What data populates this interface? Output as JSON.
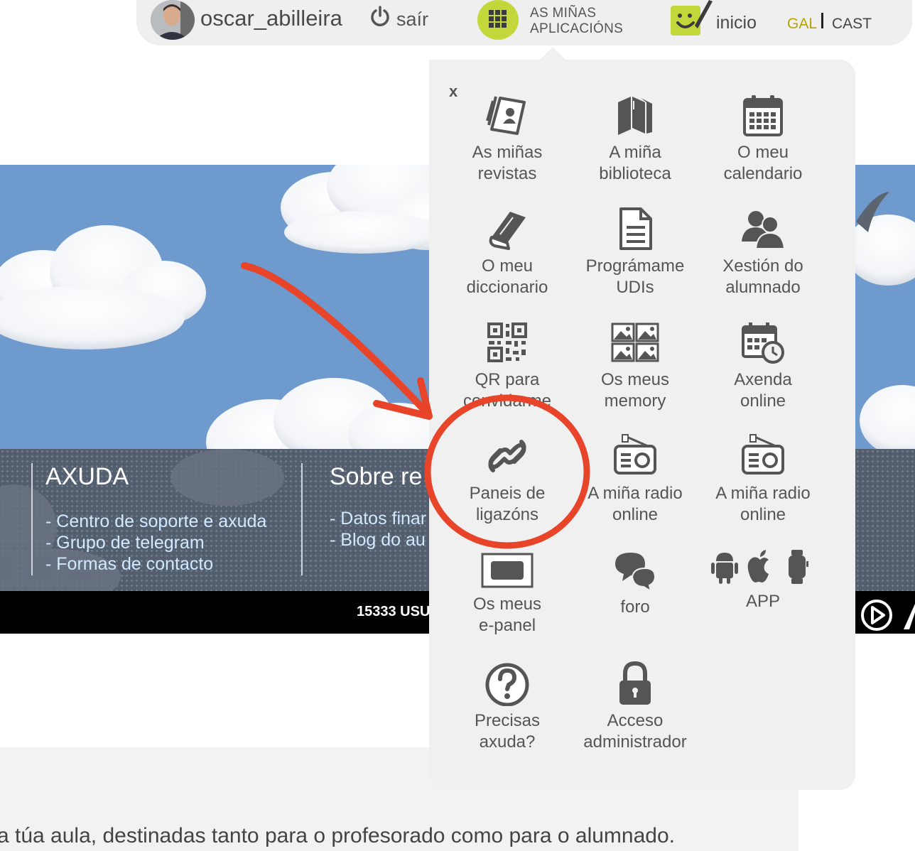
{
  "header": {
    "username": "oscar_abilleira",
    "logout_label": "saír",
    "apps_label_line1": "AS MIÑAS",
    "apps_label_line2": "APLICACIÓNS",
    "home_label": "inicio",
    "lang_gal": "GAL",
    "lang_cast": "CAST",
    "accent_color": "#c4d73a"
  },
  "footer": {
    "col1_title": "AXUDA",
    "col1_links": [
      "- Centro de soporte e axuda",
      "- Grupo de telegram",
      "- Formas de contacto"
    ],
    "col2_title": "Sobre re",
    "col2_links": [
      "- Datos finar",
      "- Blog do au"
    ],
    "users_text": "15333 USU"
  },
  "body_text": "a túa aula, destinadas tanto para o profesorado como para o alumnado.",
  "apps_menu": {
    "close_label": "x",
    "items": [
      {
        "icon": "magazines-icon",
        "line1": "As miñas",
        "line2": "revistas"
      },
      {
        "icon": "library-icon",
        "line1": "A miña",
        "line2": "biblioteca"
      },
      {
        "icon": "calendar-icon",
        "line1": "O meu",
        "line2": "calendario"
      },
      {
        "icon": "dictionary-icon",
        "line1": "O meu",
        "line2": "diccionario"
      },
      {
        "icon": "document-icon",
        "line1": "Prográmame",
        "line2": "UDIs"
      },
      {
        "icon": "students-icon",
        "line1": "Xestión do",
        "line2": "alumnado"
      },
      {
        "icon": "qr-icon",
        "line1": "QR para",
        "line2": "convidarme"
      },
      {
        "icon": "memory-icon",
        "line1": "Os meus",
        "line2": "memory"
      },
      {
        "icon": "agenda-icon",
        "line1": "Axenda",
        "line2": "online"
      },
      {
        "icon": "link-icon",
        "line1": "Paneis de",
        "line2": "ligazóns"
      },
      {
        "icon": "radio-icon",
        "line1": "A miña radio",
        "line2": "online"
      },
      {
        "icon": "radio-icon",
        "line1": "A miña radio",
        "line2": "online"
      },
      {
        "icon": "epanel-icon",
        "line1": "Os meus",
        "line2": "e-panel"
      },
      {
        "icon": "forum-icon",
        "line1": "foro",
        "line2": ""
      },
      {
        "icon": "devices-icon",
        "line1": "APP",
        "line2": ""
      },
      {
        "icon": "help-icon",
        "line1": "Precisas",
        "line2": "axuda?"
      },
      {
        "icon": "lock-icon",
        "line1": "Acceso",
        "line2": "administrador"
      }
    ]
  },
  "annotation_color": "#e8442a"
}
